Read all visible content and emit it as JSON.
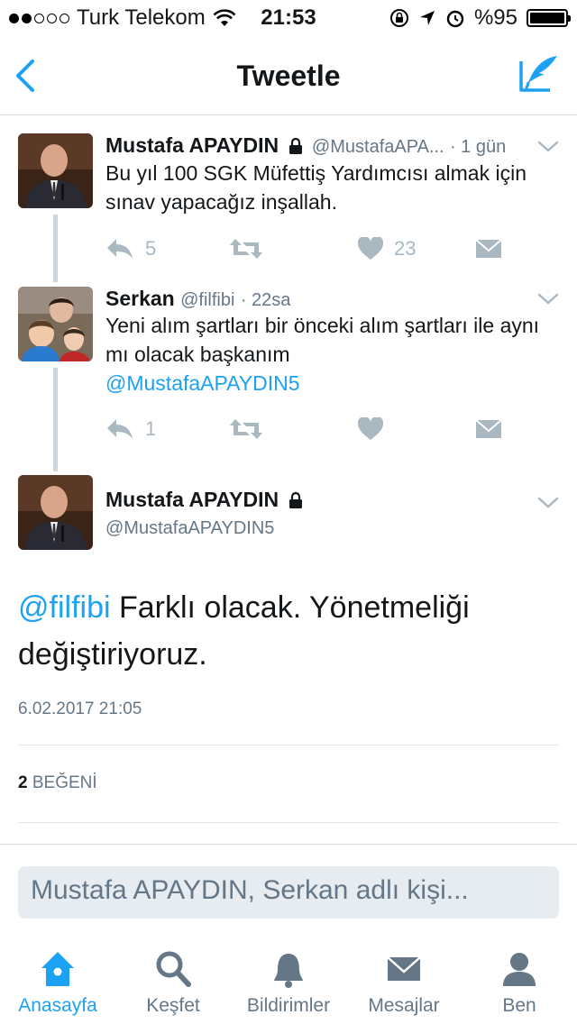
{
  "status_bar": {
    "carrier": "Turk Telekom",
    "time": "21:53",
    "battery": "%95"
  },
  "nav": {
    "title": "Tweetle"
  },
  "tweets": [
    {
      "name": "Mustafa APAYDIN",
      "handle": "@MustafaAPA...",
      "time": "· 1 gün",
      "text": "Bu yıl 100 SGK Müfettiş Yardımcısı almak için sınav yapacağız inşallah.",
      "replies": "5",
      "likes": "23"
    },
    {
      "name": "Serkan",
      "handle": "@filfibi",
      "time": "· 22sa",
      "text": "Yeni alım şartları bir önceki alım şartları ile aynı mı olacak başkanım",
      "mention": "@MustafaAPAYDIN5",
      "replies": "1"
    }
  ],
  "focused_tweet": {
    "name": "Mustafa APAYDIN",
    "handle": "@MustafaAPAYDIN5",
    "mention": "@filfibi",
    "text": "Farklı olacak. Yönetmeliği değiştiriyoruz.",
    "timestamp": "6.02.2017 21:05",
    "like_count": "2",
    "like_label": "BEĞENİ"
  },
  "reply": {
    "placeholder": "Mustafa APAYDIN, Serkan adlı kişi..."
  },
  "tabs": [
    {
      "label": "Anasayfa",
      "icon": "home-icon"
    },
    {
      "label": "Keşfet",
      "icon": "search-icon"
    },
    {
      "label": "Bildirimler",
      "icon": "bell-icon"
    },
    {
      "label": "Mesajlar",
      "icon": "envelope-icon"
    },
    {
      "label": "Ben",
      "icon": "person-icon"
    }
  ],
  "colors": {
    "accent": "#1da1f2",
    "muted": "#657786",
    "icon": "#aab8c2"
  }
}
